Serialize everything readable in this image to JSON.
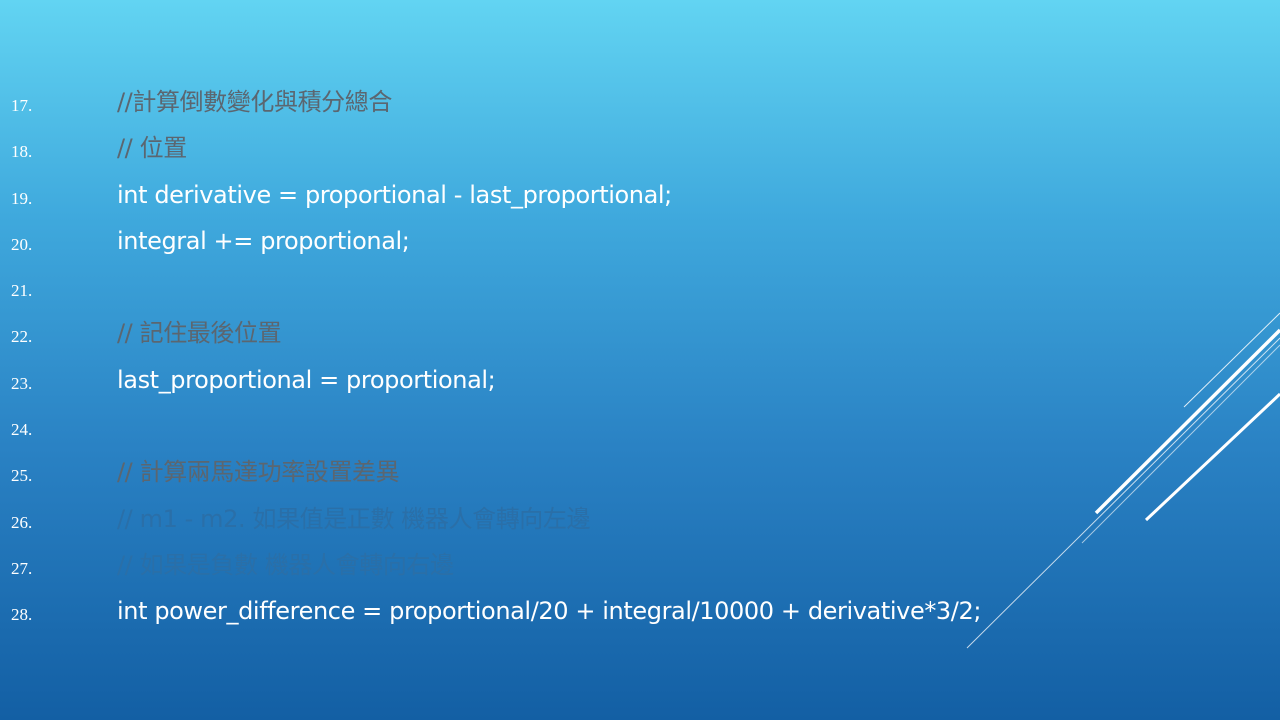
{
  "colors": {
    "code_text": "#ffffff",
    "comment_gray": "#5b6670",
    "comment_blue": "#2a6fa8",
    "background_top": "#62d4f2",
    "background_bottom": "#135fa4"
  },
  "lines": [
    {
      "num": "17.",
      "text": "//計算倒數變化與積分總合"
    },
    {
      "num": "18.",
      "text": "// 位置"
    },
    {
      "num": "19.",
      "text": "int derivative = proportional - last_proportional;"
    },
    {
      "num": "20.",
      "text": "integral += proportional;"
    },
    {
      "num": "21.",
      "text": ""
    },
    {
      "num": "22.",
      "text": "// 記住最後位置"
    },
    {
      "num": "23.",
      "text": "last_proportional = proportional;"
    },
    {
      "num": "24.",
      "text": ""
    },
    {
      "num": "25.",
      "text": "// 計算兩馬達功率設置差異"
    },
    {
      "num": "26.",
      "text": "// m1 - m2. 如果值是正數 機器人會轉向左邊"
    },
    {
      "num": "27.",
      "text": "// 如果是負數 機器人會轉向右邊"
    },
    {
      "num": "28.",
      "text": "int power_difference = proportional/20 + integral/10000 + derivative*3/2;"
    }
  ]
}
